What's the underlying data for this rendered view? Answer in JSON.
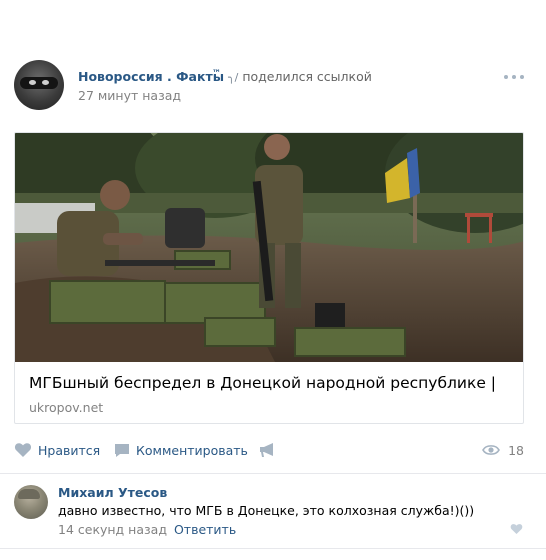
{
  "post": {
    "author": "Новороссия . Факты",
    "author_tm": "™",
    "author_mark": "╮/",
    "action": "поделился ссылкой",
    "time": "27 минут назад",
    "icons": {
      "avatar": "masked-face-avatar",
      "more": "more-dots-icon"
    }
  },
  "link_card": {
    "title": "МГБшный беспредел в Донецкой народной республике |",
    "domain": "ukropov.net",
    "image": "photo-of-soldiers-with-ammunition-crates-and-ukrainian-flag"
  },
  "actions": {
    "like_label": "Нравится",
    "comment_label": "Комментировать",
    "views_count": "18",
    "icons": {
      "like": "heart-icon",
      "comment": "comment-bubble-icon",
      "share": "share-megaphone-icon",
      "views": "eye-icon"
    }
  },
  "comment": {
    "author": "Михаил Утесов",
    "text": "давно известно, что МГБ в Донецке, это колхозная служба!)())",
    "time": "14 секунд назад",
    "reply_label": "Ответить",
    "icons": {
      "avatar": "commenter-avatar",
      "like": "heart-icon"
    }
  },
  "colors": {
    "link": "#2a5885",
    "secondary_text": "#828282",
    "icon": "#a6b4c2",
    "divider": "#e7e8ec"
  }
}
